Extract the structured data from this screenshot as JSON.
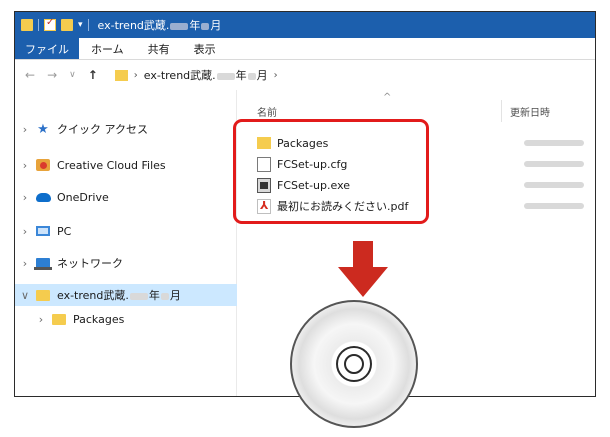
{
  "titlebar": {
    "title_prefix": "ex-trend武蔵.",
    "title_year_suffix": "年",
    "title_month_suffix": "月"
  },
  "menubar": {
    "items": [
      "ファイル",
      "ホーム",
      "共有",
      "表示"
    ]
  },
  "addressbar": {
    "back_icon": "arrow-left-icon",
    "forward_icon": "arrow-right-icon",
    "recent_icon": "chevron-down-icon",
    "up_icon": "arrow-up-icon",
    "crumb_prefix": "ex-trend武蔵.",
    "crumb_year_suffix": "年",
    "crumb_month_suffix": "月"
  },
  "navigation_pane": {
    "items": [
      {
        "label": "クイック アクセス",
        "icon": "star-icon"
      },
      {
        "label": "Creative Cloud Files",
        "icon": "creative-cloud-icon"
      },
      {
        "label": "OneDrive",
        "icon": "cloud-icon"
      },
      {
        "label": "PC",
        "icon": "computer-icon"
      },
      {
        "label": "ネットワーク",
        "icon": "network-icon"
      },
      {
        "label_prefix": "ex-trend武蔵.",
        "label_year_suffix": "年",
        "label_month_suffix": "月",
        "icon": "folder-icon",
        "selected": true
      },
      {
        "label": "Packages",
        "icon": "folder-icon"
      }
    ]
  },
  "file_list": {
    "columns": {
      "name": "名前",
      "date": "更新日時"
    },
    "files": [
      {
        "name": "Packages",
        "icon": "folder-icon"
      },
      {
        "name": "FCSet-up.cfg",
        "icon": "document-icon"
      },
      {
        "name": "FCSet-up.exe",
        "icon": "executable-icon"
      },
      {
        "name": "最初にお読みください.pdf",
        "icon": "pdf-icon"
      }
    ]
  },
  "colors": {
    "titlebar": "#1c5fad",
    "highlight_border": "#e21b1b",
    "arrow": "#cc2a1f",
    "selected_row": "#cce8ff",
    "folder": "#f5cc4e"
  },
  "overlay": {
    "arrow_icon": "arrow-down-icon",
    "disc_icon": "cd-disc-icon"
  }
}
